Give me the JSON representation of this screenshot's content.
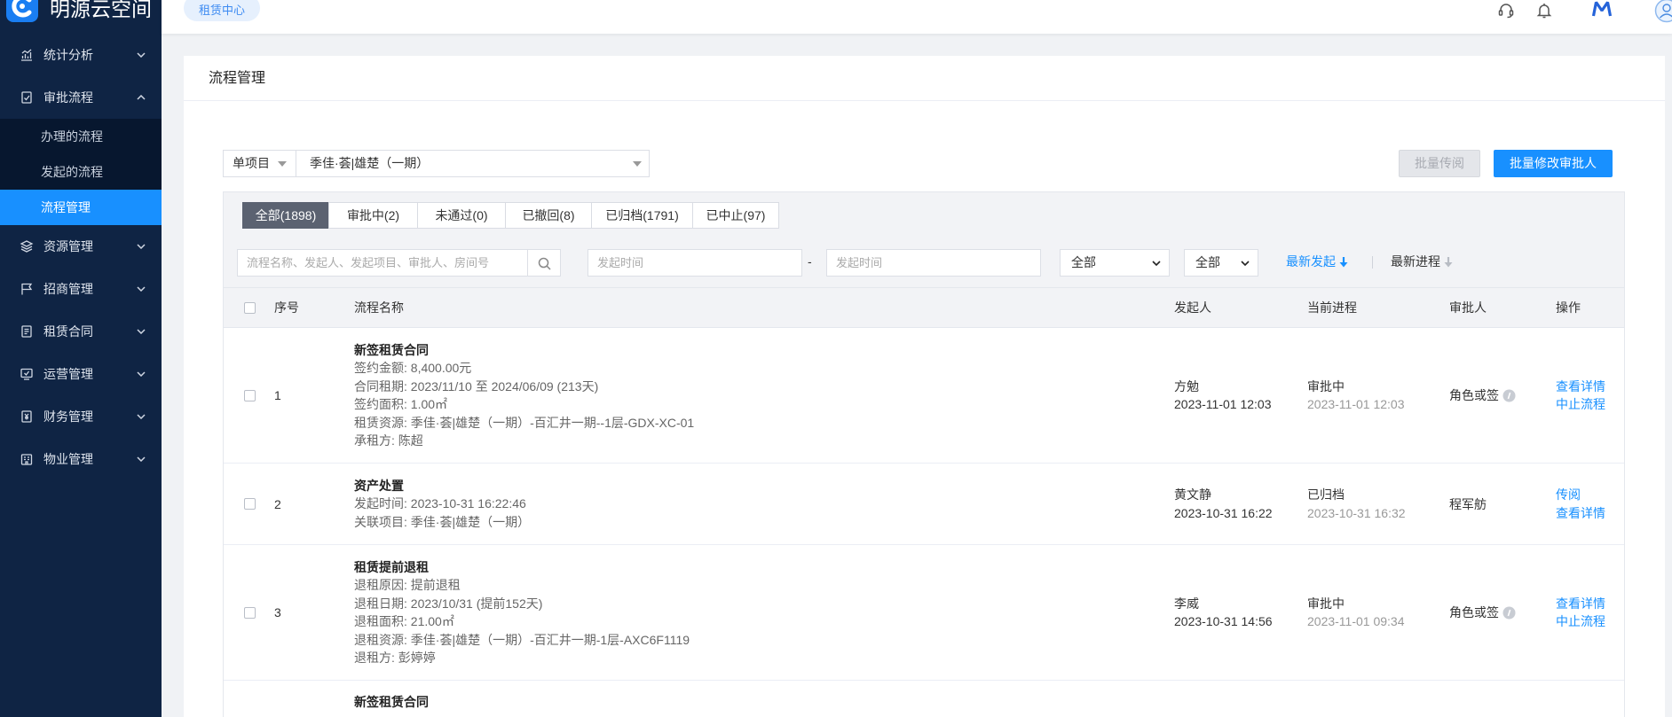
{
  "app": {
    "logo_text": "明源云空间",
    "center_tag": "租赁中心"
  },
  "colors": {
    "sidebar_bg": "#0f2444",
    "accent": "#1890ff",
    "active_tab_bg": "#5b6271",
    "disabled_button_bg": "#e4e6ea"
  },
  "header": {
    "icons": [
      "headset-icon",
      "bell-icon",
      "brand-m-icon",
      "avatar"
    ]
  },
  "sidebar": {
    "menu": [
      {
        "label": "统计分析",
        "icon": "chart-icon",
        "expanded": false
      },
      {
        "label": "审批流程",
        "icon": "approval-icon",
        "expanded": true
      },
      {
        "label": "资源管理",
        "icon": "resource-icon",
        "expanded": false
      },
      {
        "label": "招商管理",
        "icon": "flag-icon",
        "expanded": false
      },
      {
        "label": "租赁合同",
        "icon": "contract-icon",
        "expanded": false
      },
      {
        "label": "运营管理",
        "icon": "operation-icon",
        "expanded": false
      },
      {
        "label": "财务管理",
        "icon": "finance-icon",
        "expanded": false
      },
      {
        "label": "物业管理",
        "icon": "property-icon",
        "expanded": false
      }
    ],
    "approval_sub": [
      {
        "label": "办理的流程",
        "active": false
      },
      {
        "label": "发起的流程",
        "active": false
      },
      {
        "label": "流程管理",
        "active": true
      }
    ]
  },
  "page": {
    "title": "流程管理"
  },
  "filters": {
    "scope": "单项目",
    "project": "季佳·荟|雄楚（一期）",
    "batch_forward": "批量传阅",
    "batch_change_approver": "批量修改审批人"
  },
  "tabs": {
    "active": 0,
    "items": [
      "全部(1898)",
      "审批中(2)",
      "未通过(0)",
      "已撤回(8)",
      "已归档(1791)",
      "已中止(97)"
    ]
  },
  "search": {
    "placeholder": "流程名称、发起人、发起项目、审批人、房间号",
    "start_date_placeholder": "发起时间",
    "date_separator": "-",
    "end_date_placeholder": "发起时间",
    "status_select": "全部",
    "type_select": "全部",
    "sort_initiated": "最新发起",
    "sort_progress": "最新进程"
  },
  "table": {
    "columns": [
      "序号",
      "流程名称",
      "发起人",
      "当前进程",
      "审批人",
      "操作"
    ],
    "rows": [
      {
        "index": "1",
        "title": "新签租赁合同",
        "details": [
          "签约金额: 8,400.00元",
          "合同租期: 2023/11/10 至 2024/06/09 (213天)",
          "签约面积: 1.00㎡",
          "租赁资源: 季佳·荟|雄楚（一期）-百汇井一期--1层-GDX-XC-01",
          "承租方: 陈超"
        ],
        "initiator": {
          "name": "方勉",
          "time": "2023-11-01 12:03"
        },
        "progress": {
          "status": "审批中",
          "time": "2023-11-01 12:03"
        },
        "approver": "角色或签",
        "approver_info_icon": true,
        "actions": [
          "查看详情",
          "中止流程"
        ]
      },
      {
        "index": "2",
        "title": "资产处置",
        "details": [
          "发起时间: 2023-10-31 16:22:46",
          "关联项目: 季佳·荟|雄楚（一期）"
        ],
        "initiator": {
          "name": "黄文静",
          "time": "2023-10-31 16:22"
        },
        "progress": {
          "status": "已归档",
          "time": "2023-10-31 16:32"
        },
        "approver": "程军舫",
        "approver_info_icon": false,
        "actions": [
          "传阅",
          "查看详情"
        ]
      },
      {
        "index": "3",
        "title": "租赁提前退租",
        "details": [
          "退租原因: 提前退租",
          "退租日期: 2023/10/31 (提前152天)",
          "退租面积: 21.00㎡",
          "退租资源: 季佳·荟|雄楚（一期）-百汇井一期-1层-AXC6F1119",
          "退租方: 彭婷婷"
        ],
        "initiator": {
          "name": "李威",
          "time": "2023-10-31 14:56"
        },
        "progress": {
          "status": "审批中",
          "time": "2023-11-01 09:34"
        },
        "approver": "角色或签",
        "approver_info_icon": true,
        "actions": [
          "查看详情",
          "中止流程"
        ]
      },
      {
        "title": "新签租赁合同"
      }
    ]
  }
}
